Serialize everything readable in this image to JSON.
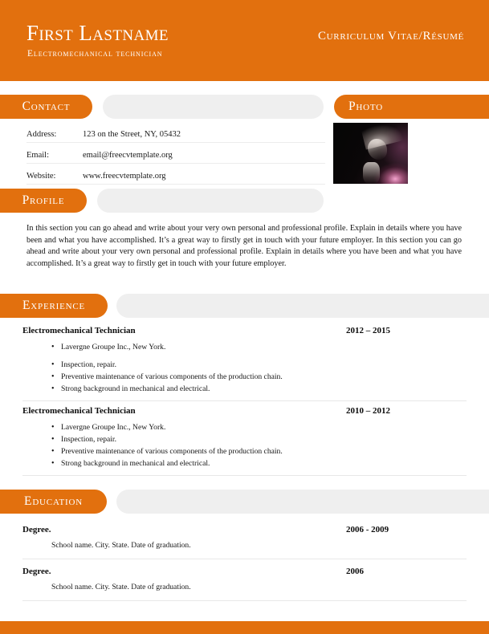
{
  "theme": {
    "accent": "#e2700e",
    "greybar": "#efefef",
    "text": "#141414",
    "rule": "#e8e8e8"
  },
  "header": {
    "name": "First Lastname",
    "subtitle": "Electromechanical technician",
    "doctype": "Curriculum Vitae/Résumé"
  },
  "contact": {
    "tab_label": "Contact",
    "rows": [
      {
        "label": "Address:",
        "value": "123 on the Street, NY, 05432"
      },
      {
        "label": "Email:",
        "value": "email@freecvtemplate.org"
      },
      {
        "label": "Website:",
        "value": "www.freecvtemplate.org"
      }
    ]
  },
  "photo": {
    "tab_label": "Photo",
    "image_alt": "portrait-photo"
  },
  "profile": {
    "tab_label": "Profile",
    "text": "In this section you can go ahead and write about your very own personal and professional profile. Explain in details where you have been and what you have accomplished. It’s a great way to firstly get in touch with your future employer. In this section you can go ahead and write about your very own personal and professional profile. Explain in details where you have been and what you have accomplished. It’s a great way to firstly get in touch with your future employer."
  },
  "experience": {
    "tab_label": "Experience",
    "entries": [
      {
        "title": "Electromechanical Technician",
        "date": "2012 – 2015",
        "bullets": [
          "Lavergne Groupe Inc., New York.",
          "Inspection, repair.",
          "Preventive maintenance of various components of the production chain.",
          "Strong background in mechanical and electrical."
        ]
      },
      {
        "title": "Electromechanical Technician",
        "date": "2010 – 2012",
        "bullets": [
          "Lavergne Groupe Inc., New York.",
          "Inspection, repair.",
          "Preventive maintenance of various components of the production chain.",
          "Strong background in mechanical and electrical."
        ]
      }
    ]
  },
  "education": {
    "tab_label": "Education",
    "entries": [
      {
        "degree": "Degree.",
        "date": "2006 - 2009",
        "school": "School name. City. State. Date of graduation."
      },
      {
        "degree": "Degree.",
        "date": "2006",
        "school": "School name. City. State. Date of graduation."
      }
    ]
  }
}
